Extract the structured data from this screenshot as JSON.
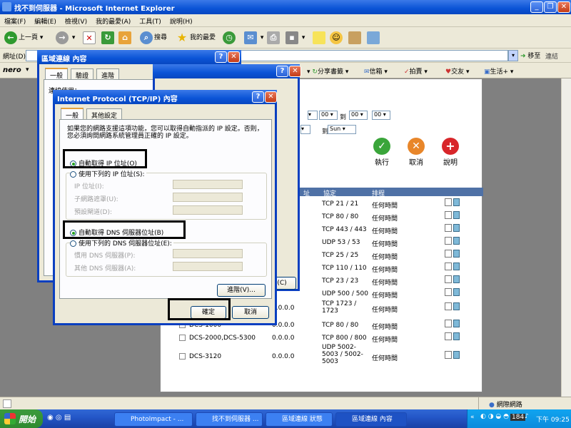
{
  "window": {
    "title": "找不到伺服器 - Microsoft Internet Explorer"
  },
  "menu": [
    "檔案(F)",
    "編輯(E)",
    "檢視(V)",
    "我的最愛(A)",
    "工具(T)",
    "說明(H)"
  ],
  "toolbar": {
    "back": "上一頁",
    "search": "搜尋",
    "favorites": "我的最愛"
  },
  "address": {
    "label": "網址(D)",
    "go": "移至",
    "links": "連結"
  },
  "nero_bar": {
    "logo": "nero",
    "items": [
      "分享書籤",
      "信箱",
      "拍賣",
      "交友",
      "生活+"
    ]
  },
  "page": {
    "day_to": "到",
    "day_from_value": "Sun",
    "time_values": [
      "00",
      "00",
      "00",
      "00"
    ],
    "actions": {
      "run": "執行",
      "cancel": "取消",
      "help": "說明"
    },
    "table_headers": {
      "protocol": "協定",
      "schedule": "排程",
      "addr_col": "址"
    },
    "rows": [
      {
        "name": "",
        "ip": "",
        "protocol": "TCP 21 / 21",
        "schedule": "任何時間"
      },
      {
        "name": "",
        "ip": "",
        "protocol": "TCP 80 / 80",
        "schedule": "任何時間"
      },
      {
        "name": "",
        "ip": "",
        "protocol": "TCP 443 / 443",
        "schedule": "任何時間"
      },
      {
        "name": "",
        "ip": "",
        "protocol": "UDP 53 / 53",
        "schedule": "任何時間"
      },
      {
        "name": "",
        "ip": "",
        "protocol": "TCP 25 / 25",
        "schedule": "任何時間"
      },
      {
        "name": "",
        "ip": "",
        "protocol": "TCP 110 / 110",
        "schedule": "任何時間"
      },
      {
        "name": "",
        "ip": "",
        "protocol": "TCP 23 / 23",
        "schedule": "任何時間"
      },
      {
        "name": "",
        "ip": "",
        "protocol": "UDP 500 / 500",
        "schedule": "任何時間"
      },
      {
        "name": "",
        "ip": "0.0.0.0",
        "protocol": "TCP 1723 / 1723",
        "schedule": "任何時間"
      },
      {
        "name": "DCS-1000",
        "ip": "0.0.0.0",
        "protocol": "TCP 80 / 80",
        "schedule": "任何時間"
      },
      {
        "name": "DCS-2000,DCS-5300",
        "ip": "0.0.0.0",
        "protocol": "TCP 800 / 800",
        "schedule": "任何時間"
      },
      {
        "name": "DCS-3120",
        "ip": "0.0.0.0",
        "protocol": "UDP 5002-5003 / 5002-5003",
        "schedule": "任何時間"
      }
    ]
  },
  "status": {
    "zone": "網際網路"
  },
  "taskbar": {
    "start": "開始",
    "tasks": [
      "PhotoImpact - ...",
      "找不到伺服器 ...",
      "區域連線 狀態",
      "區域連線 內容"
    ],
    "clock": "下午 09:25",
    "badge": "184"
  },
  "dlg_props": {
    "title": "區域連線 內容",
    "tabs": [
      "一般",
      "驗證",
      "進階"
    ],
    "connect_using": "連線使用：",
    "help": "?",
    "close": "✕"
  },
  "dlg_status": {
    "help": "?",
    "close": "✕",
    "partial_button": "(C)"
  },
  "dlg_tcpip": {
    "title": "Internet Protocol (TCP/IP) 內容",
    "tabs": [
      "一般",
      "其他設定"
    ],
    "description": "如果您的網路支援這項功能，您可以取得自動指派的 IP 設定。否則，您必須詢問網路系統管理員正確的 IP 設定。",
    "auto_ip": "自動取得 IP 位址(O)",
    "manual_ip": "使用下列的 IP 位址(S):",
    "ip_label": "IP 位址(I):",
    "mask_label": "子網路遮罩(U):",
    "gateway_label": "預設閘道(D):",
    "auto_dns": "自動取得 DNS 伺服器位址(B)",
    "manual_dns": "使用下列的 DNS 伺服器位址(E):",
    "pref_dns_label": "慣用 DNS 伺服器(P):",
    "alt_dns_label": "其他 DNS 伺服器(A):",
    "advanced": "進階(V)...",
    "ok": "確定",
    "cancel": "取消",
    "help": "?",
    "close": "✕"
  },
  "colors": {
    "titlebar": "#0a53d6",
    "taskbar": "#2457c8",
    "table_header": "#4f71a6"
  }
}
